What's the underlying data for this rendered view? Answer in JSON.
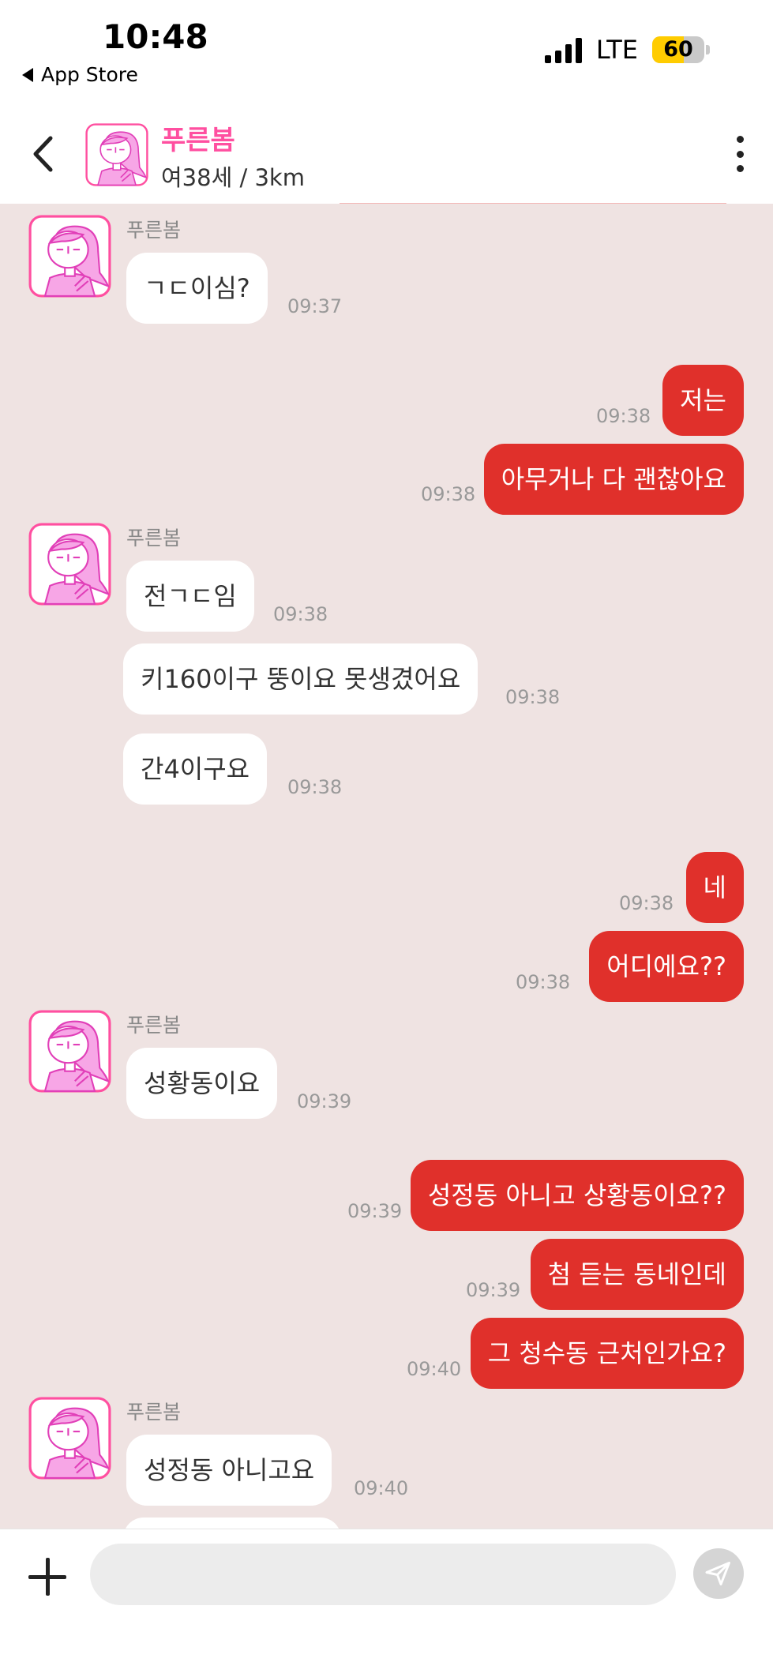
{
  "status_bar": {
    "time": "10:48",
    "back_label": "App Store",
    "network": "LTE",
    "battery": "60",
    "battery_level": 0.6
  },
  "header": {
    "name": "푸른봄",
    "info": "여38세 / 3km"
  },
  "messages": [
    {
      "sender": "푸른봄",
      "text": "ㄱㄷ이심?",
      "time": "09:37"
    },
    {
      "text": "저는",
      "time": "09:38"
    },
    {
      "text": "아무거나 다 괜찮아요",
      "time": "09:38"
    },
    {
      "sender": "푸른봄",
      "text": "전ㄱㄷ임",
      "time": "09:38"
    },
    {
      "text": "키160이구 뚱이요 못생겼어요",
      "time": "09:38"
    },
    {
      "text": "간4이구요",
      "time": "09:38"
    },
    {
      "text": "네",
      "time": "09:38"
    },
    {
      "text": "어디에요??",
      "time": "09:38"
    },
    {
      "sender": "푸른봄",
      "text": "성황동이요",
      "time": "09:39"
    },
    {
      "text": "성정동 아니고 상황동이요??",
      "time": "09:39"
    },
    {
      "text": "첨 듣는 동네인데",
      "time": "09:39"
    },
    {
      "text": "그 청수동 근처인가요?",
      "time": "09:40"
    },
    {
      "sender": "푸른봄",
      "text": "성정동 아니고요",
      "time": "09:40"
    }
  ],
  "input": {
    "placeholder": ""
  },
  "colors": {
    "accent": "#ff4fa0",
    "outgoing_bubble": "#e0302b",
    "chat_background": "#efe3e2"
  }
}
